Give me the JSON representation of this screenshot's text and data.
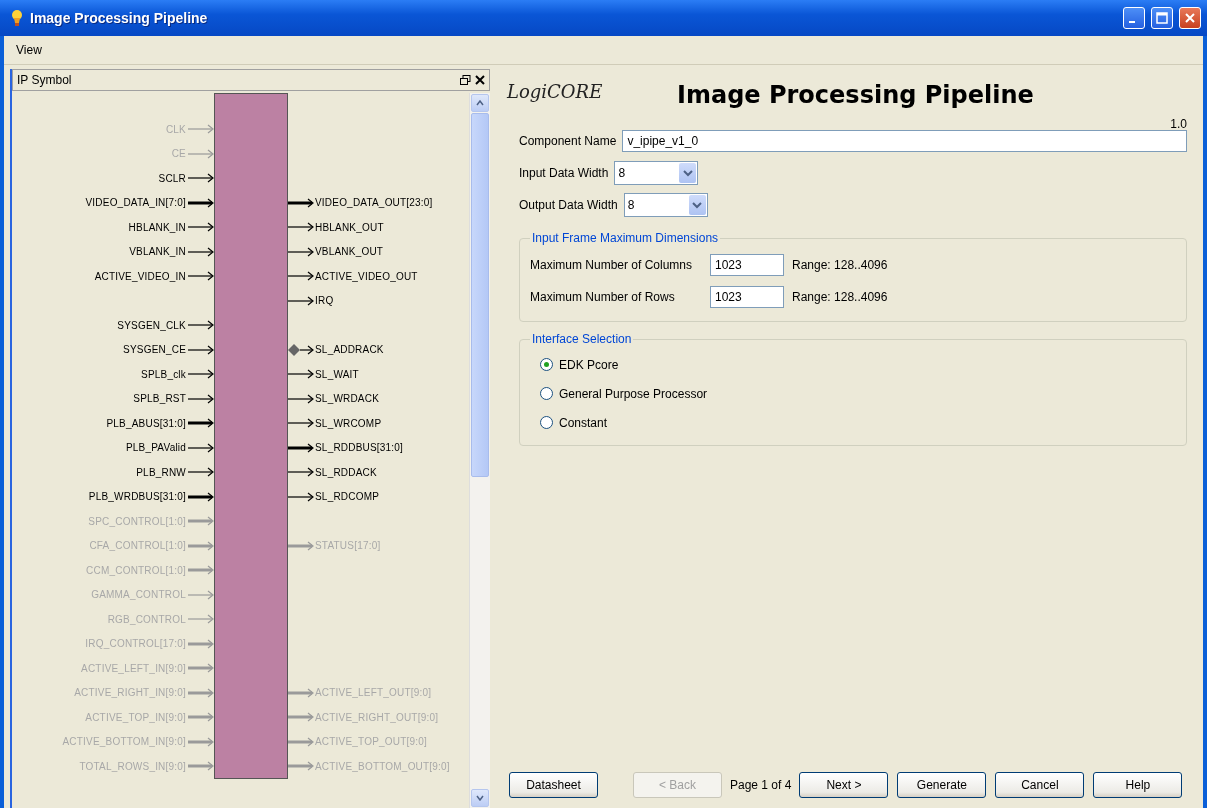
{
  "window": {
    "title": "Image Processing Pipeline"
  },
  "menu": [
    {
      "label": "View"
    }
  ],
  "symbol_panel": {
    "title": "IP Symbol",
    "rows": [
      {
        "left": {
          "name": "CLK",
          "enabled": false,
          "bus": false
        }
      },
      {
        "left": {
          "name": "CE",
          "enabled": false,
          "bus": false
        }
      },
      {
        "left": {
          "name": "SCLR",
          "enabled": true,
          "bus": false
        }
      },
      {
        "left": {
          "name": "VIDEO_DATA_IN[7:0]",
          "enabled": true,
          "bus": true
        },
        "right": {
          "name": "VIDEO_DATA_OUT[23:0]",
          "enabled": true,
          "bus": true,
          "kind": "arrow"
        }
      },
      {
        "left": {
          "name": "HBLANK_IN",
          "enabled": true,
          "bus": false
        },
        "right": {
          "name": "HBLANK_OUT",
          "enabled": true,
          "bus": false,
          "kind": "arrow"
        }
      },
      {
        "left": {
          "name": "VBLANK_IN",
          "enabled": true,
          "bus": false
        },
        "right": {
          "name": "VBLANK_OUT",
          "enabled": true,
          "bus": false,
          "kind": "arrow"
        }
      },
      {
        "left": {
          "name": "ACTIVE_VIDEO_IN",
          "enabled": true,
          "bus": false
        },
        "right": {
          "name": "ACTIVE_VIDEO_OUT",
          "enabled": true,
          "bus": false,
          "kind": "arrow"
        }
      },
      {
        "right": {
          "name": "IRQ",
          "enabled": true,
          "bus": false,
          "kind": "arrow"
        }
      },
      {
        "left": {
          "name": "SYSGEN_CLK",
          "enabled": true,
          "bus": false
        }
      },
      {
        "left": {
          "name": "SYSGEN_CE",
          "enabled": true,
          "bus": false
        },
        "right": {
          "name": "SL_ADDRACK",
          "enabled": true,
          "bus": false,
          "kind": "diamond"
        }
      },
      {
        "left": {
          "name": "SPLB_clk",
          "enabled": true,
          "bus": false
        },
        "right": {
          "name": "SL_WAIT",
          "enabled": true,
          "bus": false,
          "kind": "arrow"
        }
      },
      {
        "left": {
          "name": "SPLB_RST",
          "enabled": true,
          "bus": false
        },
        "right": {
          "name": "SL_WRDACK",
          "enabled": true,
          "bus": false,
          "kind": "arrow"
        }
      },
      {
        "left": {
          "name": "PLB_ABUS[31:0]",
          "enabled": true,
          "bus": true
        },
        "right": {
          "name": "SL_WRCOMP",
          "enabled": true,
          "bus": false,
          "kind": "arrow"
        }
      },
      {
        "left": {
          "name": "PLB_PAValid",
          "enabled": true,
          "bus": false
        },
        "right": {
          "name": "SL_RDDBUS[31:0]",
          "enabled": true,
          "bus": true,
          "kind": "arrow"
        }
      },
      {
        "left": {
          "name": "PLB_RNW",
          "enabled": true,
          "bus": false
        },
        "right": {
          "name": "SL_RDDACK",
          "enabled": true,
          "bus": false,
          "kind": "arrow"
        }
      },
      {
        "left": {
          "name": "PLB_WRDBUS[31:0]",
          "enabled": true,
          "bus": true
        },
        "right": {
          "name": "SL_RDCOMP",
          "enabled": true,
          "bus": false,
          "kind": "arrow"
        }
      },
      {
        "left": {
          "name": "SPC_CONTROL[1:0]",
          "enabled": false,
          "bus": true
        }
      },
      {
        "left": {
          "name": "CFA_CONTROL[1:0]",
          "enabled": false,
          "bus": true
        },
        "right": {
          "name": "STATUS[17:0]",
          "enabled": false,
          "bus": true,
          "kind": "arrow"
        }
      },
      {
        "left": {
          "name": "CCM_CONTROL[1:0]",
          "enabled": false,
          "bus": true
        }
      },
      {
        "left": {
          "name": "GAMMA_CONTROL",
          "enabled": false,
          "bus": false
        }
      },
      {
        "left": {
          "name": "RGB_CONTROL",
          "enabled": false,
          "bus": false
        }
      },
      {
        "left": {
          "name": "IRQ_CONTROL[17:0]",
          "enabled": false,
          "bus": true
        }
      },
      {
        "left": {
          "name": "ACTIVE_LEFT_IN[9:0]",
          "enabled": false,
          "bus": true
        }
      },
      {
        "left": {
          "name": "ACTIVE_RIGHT_IN[9:0]",
          "enabled": false,
          "bus": true
        },
        "right": {
          "name": "ACTIVE_LEFT_OUT[9:0]",
          "enabled": false,
          "bus": true,
          "kind": "arrow"
        }
      },
      {
        "left": {
          "name": "ACTIVE_TOP_IN[9:0]",
          "enabled": false,
          "bus": true
        },
        "right": {
          "name": "ACTIVE_RIGHT_OUT[9:0]",
          "enabled": false,
          "bus": true,
          "kind": "arrow"
        }
      },
      {
        "left": {
          "name": "ACTIVE_BOTTOM_IN[9:0]",
          "enabled": false,
          "bus": true
        },
        "right": {
          "name": "ACTIVE_TOP_OUT[9:0]",
          "enabled": false,
          "bus": true,
          "kind": "arrow"
        }
      },
      {
        "left": {
          "name": "TOTAL_ROWS_IN[9:0]",
          "enabled": false,
          "bus": true
        },
        "right": {
          "name": "ACTIVE_BOTTOM_OUT[9:0]",
          "enabled": false,
          "bus": true,
          "kind": "arrow"
        }
      }
    ]
  },
  "header": {
    "logo": "LogiCORE",
    "title": "Image Processing Pipeline",
    "version": "1.0"
  },
  "fields": [
    {
      "label": "Component Name",
      "value": "v_ipipe_v1_0",
      "kind": "text"
    },
    {
      "label": "Input Data Width",
      "value": "8",
      "kind": "dropdown"
    },
    {
      "label": "Output Data Width",
      "value": "8",
      "kind": "dropdown"
    }
  ],
  "frame_dimensions": {
    "title": "Input Frame Maximum Dimensions",
    "rows": [
      {
        "label": "Maximum Number of Columns",
        "value": "1023",
        "range": "Range: 128..4096"
      },
      {
        "label": "Maximum Number of Rows",
        "value": "1023",
        "range": "Range: 128..4096"
      }
    ]
  },
  "interface_selection": {
    "title": "Interface Selection",
    "options": [
      {
        "label": "EDK Pcore",
        "selected": true
      },
      {
        "label": "General Purpose Processor",
        "selected": false
      },
      {
        "label": "Constant",
        "selected": false
      }
    ]
  },
  "footer": [
    {
      "kind": "button",
      "label": "Datasheet",
      "disabled": false
    },
    {
      "kind": "button",
      "label": "< Back",
      "disabled": true
    },
    {
      "kind": "text",
      "label": "Page 1 of 4"
    },
    {
      "kind": "button",
      "label": "Next >",
      "disabled": false
    },
    {
      "kind": "button",
      "label": "Generate",
      "disabled": false
    },
    {
      "kind": "button",
      "label": "Cancel",
      "disabled": false
    },
    {
      "kind": "button",
      "label": "Help",
      "disabled": false
    }
  ]
}
